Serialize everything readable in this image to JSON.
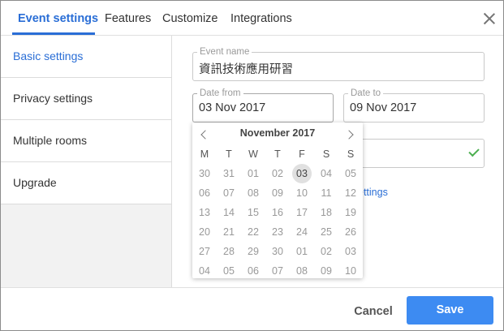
{
  "tabs": [
    {
      "label": "Event settings"
    },
    {
      "label": "Features"
    },
    {
      "label": "Customize"
    },
    {
      "label": "Integrations"
    }
  ],
  "sidebar": {
    "items": [
      {
        "label": "Basic settings"
      },
      {
        "label": "Privacy settings"
      },
      {
        "label": "Multiple rooms"
      },
      {
        "label": "Upgrade"
      }
    ]
  },
  "form": {
    "event_name": {
      "label": "Event name",
      "value": "資訊技術應用研習"
    },
    "date_from": {
      "label": "Date from",
      "value": "03 Nov 2017"
    },
    "date_to": {
      "label": "Date to",
      "value": "09 Nov 2017"
    },
    "link_partial": "ettings"
  },
  "calendar": {
    "title": "November 2017",
    "weekdays": [
      "M",
      "T",
      "W",
      "T",
      "F",
      "S",
      "S"
    ],
    "weeks": [
      [
        "30",
        "31",
        "01",
        "02",
        "03",
        "04",
        "05"
      ],
      [
        "06",
        "07",
        "08",
        "09",
        "10",
        "11",
        "12"
      ],
      [
        "13",
        "14",
        "15",
        "16",
        "17",
        "18",
        "19"
      ],
      [
        "20",
        "21",
        "22",
        "23",
        "24",
        "25",
        "26"
      ],
      [
        "27",
        "28",
        "29",
        "30",
        "01",
        "02",
        "03"
      ],
      [
        "04",
        "05",
        "06",
        "07",
        "08",
        "09",
        "10"
      ]
    ],
    "selected": "03"
  },
  "footer": {
    "cancel_label": "Cancel",
    "save_label": "Save"
  },
  "colors": {
    "accent": "#2a6ed6",
    "primary_button": "#3d8bf2",
    "success": "#4caf50"
  },
  "icons": {
    "close": "close-icon",
    "prev": "chevron-left-icon",
    "next": "chevron-right-icon",
    "valid": "checkmark-icon"
  }
}
